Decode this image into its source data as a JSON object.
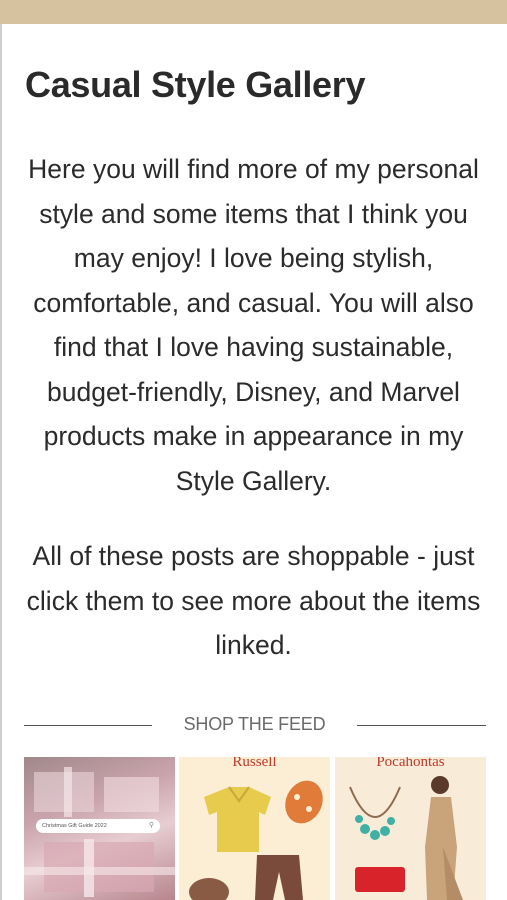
{
  "page": {
    "title": "Casual Style Gallery",
    "intro_text": "Here you will find more of my personal style and some items that I think you may enjoy! I love being stylish, comfortable, and casual. You will also find that I love having sustainable, budget-friendly, Disney, and Marvel products make in appearance in my Style Gallery.",
    "shop_note": "All of these posts are shoppable - just click them to see more about the items linked."
  },
  "feed": {
    "heading": "SHOP THE FEED",
    "tiles": [
      {
        "label": "",
        "search_text": "Christmas Gift Guide 2022"
      },
      {
        "label": "Russell"
      },
      {
        "label": "Pocahontas"
      }
    ]
  },
  "colors": {
    "top_bar": "#d6c29e",
    "heading_text": "#2a2a2a",
    "feed_heading": "#6a6a6a",
    "tile_label": "#c0392b"
  },
  "icons": [
    "search-icon"
  ]
}
